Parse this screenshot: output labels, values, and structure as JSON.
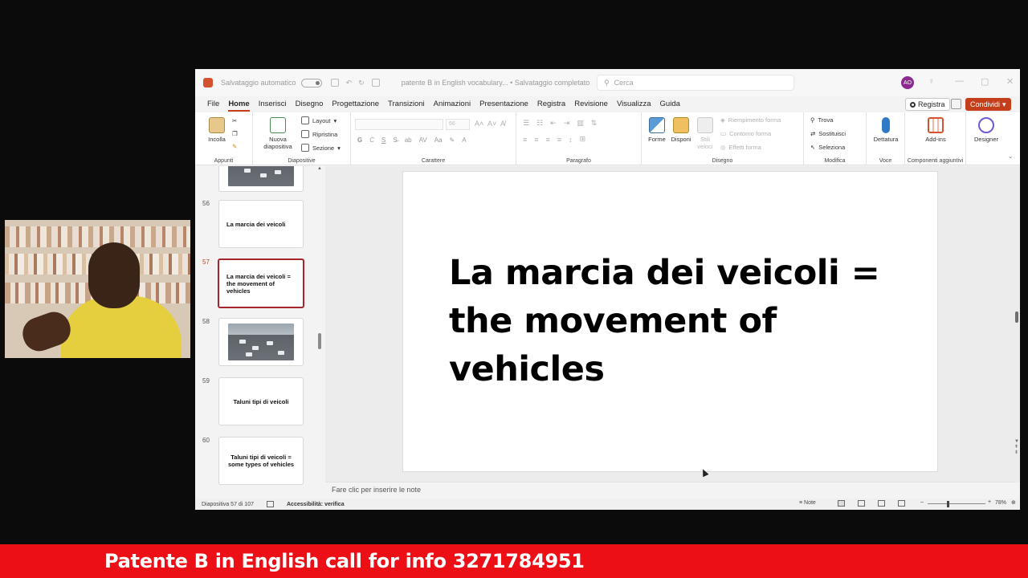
{
  "window": {
    "autosave_label": "Salvataggio automatico",
    "doc_title": "patente B in English vocabulary... • Salvataggio completato",
    "search_placeholder": "Cerca",
    "avatar_initials": "AO"
  },
  "menu": {
    "tabs": [
      "File",
      "Home",
      "Inserisci",
      "Disegno",
      "Progettazione",
      "Transizioni",
      "Animazioni",
      "Presentazione",
      "Registra",
      "Revisione",
      "Visualizza",
      "Guida"
    ],
    "active_tab": "Home",
    "record_label": "Registra",
    "share_label": "Condividi"
  },
  "ribbon": {
    "paste": "Incolla",
    "clipboard_group": "Appunti",
    "new_slide": "Nuova diapositiva",
    "layout": "Layout",
    "reset": "Ripristina",
    "section": "Sezione",
    "slides_group": "Diapositive",
    "font_size": "66",
    "font_group": "Carattere",
    "paragraph_group": "Paragrafo",
    "shapes": "Forme",
    "arrange": "Disponi",
    "quick_styles": "Stili veloci",
    "shape_fill": "Riempimento forma",
    "shape_outline": "Contorno forma",
    "shape_effects": "Effetti forma",
    "drawing_group": "Disegno",
    "find": "Trova",
    "replace": "Sostituisci",
    "select": "Seleziona",
    "editing_group": "Modifica",
    "dictate": "Dettatura",
    "voice_group": "Voce",
    "addins": "Add-ins",
    "addins_group": "Componenti aggiuntivi",
    "designer": "Designer"
  },
  "thumbnails": [
    {
      "num": "56",
      "text": "La marcia dei veicoli",
      "kind": "text",
      "selected": false
    },
    {
      "num": "57",
      "text": "La marcia dei veicoli = the movement of vehicles",
      "kind": "text",
      "selected": true
    },
    {
      "num": "58",
      "text": "",
      "kind": "image",
      "selected": false
    },
    {
      "num": "59",
      "text": "Taluni tipi di veicoli",
      "kind": "text",
      "selected": false
    },
    {
      "num": "60",
      "text": "Taluni tipi di veicoli = some types of vehicles",
      "kind": "text",
      "selected": false
    }
  ],
  "slide": {
    "title": "La marcia dei veicoli = the movement of vehicles"
  },
  "notes_placeholder": "Fare clic per inserire le note",
  "status": {
    "slide_counter": "Diapositiva 57 di 107",
    "accessibility": "Accessibilità: verifica",
    "notes": "Note",
    "zoom": "78%"
  },
  "banner": {
    "text": "Patente B in English call for info 3271784951"
  },
  "colors": {
    "accent": "#c43e1c",
    "banner": "#ec0f16",
    "selected_thumb": "#a4262c"
  }
}
